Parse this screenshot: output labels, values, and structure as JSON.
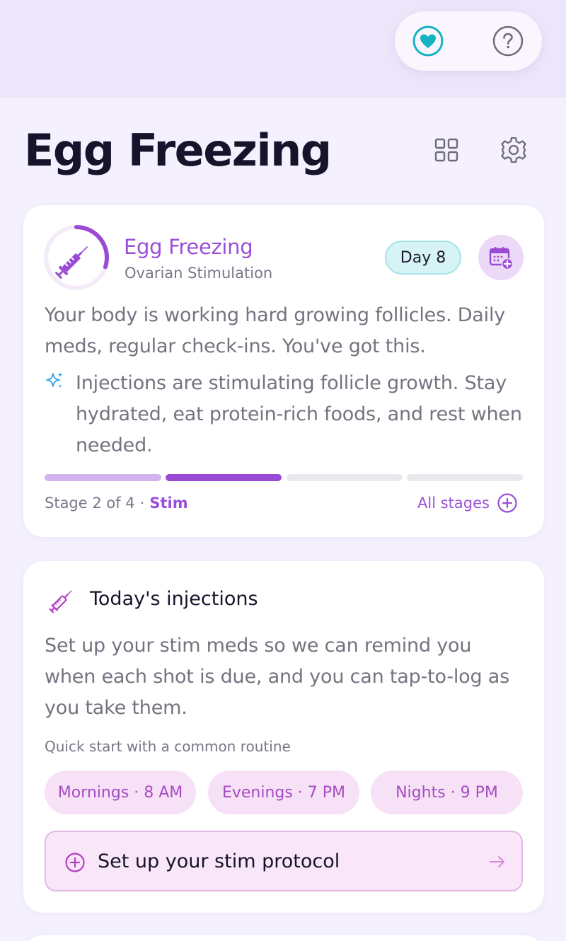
{
  "header": {
    "title": "Egg Freezing"
  },
  "stage_card": {
    "title": "Egg Freezing",
    "subtitle": "Ovarian Stimulation",
    "day_badge": "Day 8",
    "description": "Your body is working hard growing follicles. Daily meds, regular check-ins. You've got this.",
    "tip": "Injections are stimulating follicle growth. Stay hydrated, eat protein-rich foods, and rest when needed.",
    "stage_count": "Stage 2 of 4",
    "separator": "·",
    "stage_name": "Stim",
    "all_stages_label": "All stages",
    "current_stage": 2,
    "total_stages": 4,
    "ring_progress": 0.3
  },
  "injections_card": {
    "title": "Today's injections",
    "description": "Set up your stim meds so we can remind you when each shot is due, and you can tap-to-log as you take them.",
    "quick_start_label": "Quick start with a common routine",
    "routines": [
      {
        "label": "Mornings · 8 AM"
      },
      {
        "label": "Evenings · 7 PM"
      },
      {
        "label": "Nights · 9 PM"
      }
    ],
    "setup_button_label": "Set up your stim protocol"
  },
  "icons": {
    "heart_toggle": "heart-circle-icon",
    "help": "question-circle-icon",
    "grid": "grid-icon",
    "settings": "gear-icon",
    "syringe": "syringe-icon",
    "calendar_add": "calendar-add-icon",
    "sparkle": "sparkle-icon",
    "plus_circle": "plus-circle-icon",
    "arrow_right": "arrow-right-icon"
  },
  "colors": {
    "accent_purple": "#9a4fd8",
    "accent_teal": "#14b3c4",
    "chip_pink": "#f7e1f7",
    "background": "#f4f0fd"
  }
}
